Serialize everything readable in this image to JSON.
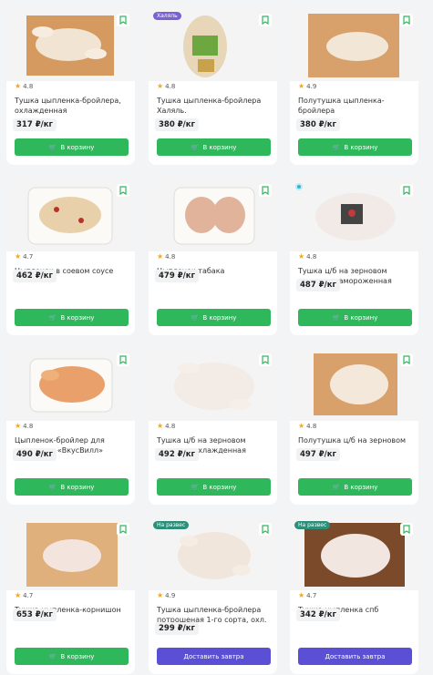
{
  "ui": {
    "cart_label": "В корзину",
    "deliver_label": "Доставить завтра"
  },
  "products": [
    {
      "name": "Тушка цыпленка-бройлера, охлажденная",
      "rating": "4.8",
      "price": "317 ₽/кг",
      "button": "cart"
    },
    {
      "name": "Тушка цыпленка-бройлера Халяль.",
      "rating": "4.8",
      "price": "380 ₽/кг",
      "badge": "Халяль",
      "button": "cart"
    },
    {
      "name": "Полутушка цыпленка-бройлера",
      "rating": "4.9",
      "price": "380 ₽/кг",
      "button": "cart"
    },
    {
      "name": "Цыпленок в соевом соусе",
      "rating": "4.7",
      "price": "462 ₽/кг",
      "button": "cart"
    },
    {
      "name": "Цыпленок табака",
      "rating": "4.8",
      "price": "479 ₽/кг",
      "button": "cart"
    },
    {
      "name": "Тушка ц/б на зерновом откорме, замороженная",
      "rating": "4.8",
      "price": "487 ₽/кг",
      "button": "cart"
    },
    {
      "name": "Цыпленок-бройлер для запекания «ВкусВилл»",
      "rating": "4.8",
      "price": "490 ₽/кг",
      "button": "cart"
    },
    {
      "name": "Тушка ц/б на зерновом откорме, охлажденная",
      "rating": "4.8",
      "price": "492 ₽/кг",
      "button": "cart"
    },
    {
      "name": "Полутушка ц/б на зерновом откорме",
      "rating": "4.8",
      "price": "497 ₽/кг",
      "button": "cart"
    },
    {
      "name": "Тушка цыпленка-корнишон",
      "rating": "4.7",
      "price": "653 ₽/кг",
      "button": "cart"
    },
    {
      "name": "Тушка цыпленка-бройлера потрошеная 1-го сорта, охл. вес",
      "rating": "4.9",
      "price": "299 ₽/кг",
      "badge": "На развес",
      "button": "deliver"
    },
    {
      "name": "Тушка цыпленка спб",
      "rating": "4.7",
      "price": "342 ₽/кг",
      "badge": "На развес",
      "button": "deliver"
    }
  ],
  "colors": {
    "green": "#2fb75c",
    "purple": "#5b4fd6",
    "star": "#f5a623"
  }
}
